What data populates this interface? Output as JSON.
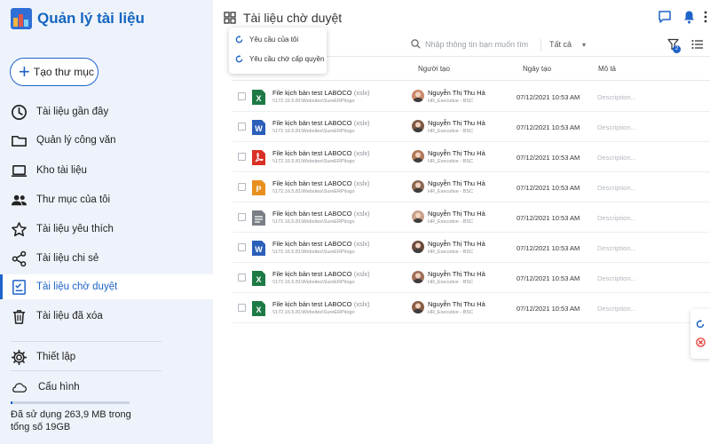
{
  "app": {
    "title": "Quản lý tài liệu"
  },
  "sidebar": {
    "new_folder_label": "Tạo thư mục",
    "items": [
      {
        "label": "Tài liệu gần đây",
        "icon": "clock-icon"
      },
      {
        "label": "Quản lý công văn",
        "icon": "folder-icon"
      },
      {
        "label": "Kho  tài liệu",
        "icon": "laptop-icon"
      },
      {
        "label": "Thư mục  của tôi",
        "icon": "people-icon"
      },
      {
        "label": "Tài liệu yêu thích",
        "icon": "star-icon"
      },
      {
        "label": "Tài liệu chi sẻ",
        "icon": "share-icon"
      },
      {
        "label": "Tài liệu chờ duyệt",
        "icon": "checklist-icon",
        "active": true
      },
      {
        "label": "Tài liệu đã xóa",
        "icon": "trash-icon"
      }
    ],
    "settings_label": "Thiết lập",
    "config_label": "Cấu hình",
    "storage": {
      "text": "Đã sử dụng 263,9 MB trong tổng số 19GB",
      "fraction": 0.0136
    }
  },
  "header": {
    "title": "Tài liệu chờ duyệt",
    "dropdown": [
      "Yêu cầu của tôi",
      "Yêu cầu chờ cấp quyền"
    ],
    "search_placeholder": "Nhập thông tin bạn muốn tìm",
    "filter_value": "Tất cả",
    "filter_badge": "2"
  },
  "table": {
    "columns": [
      "Người tạo",
      "Ngày tạo",
      "Mô tả"
    ],
    "rows": [
      {
        "type": "excel",
        "name": "File kịch bản test LABOCO",
        "ext": "(xslx)",
        "path": "\\\\172.16.5.81\\Websites\\SureERP\\logo",
        "user": "Nguyễn Thị Thu Hà",
        "role": "HR_Executive - BSC",
        "date": "07/12/2021 10:53 AM",
        "desc": "Description..."
      },
      {
        "type": "word",
        "name": "File kịch bản test LABOCO",
        "ext": "(xslx)",
        "path": "\\\\172.16.5.81\\Websites\\SureERP\\logo",
        "user": "Nguyễn Thị Thu Hà",
        "role": "HR_Executive - BSC",
        "date": "07/12/2021 10:53 AM",
        "desc": "Description..."
      },
      {
        "type": "pdf",
        "name": "File kịch bản test LABOCO",
        "ext": "(xslx)",
        "path": "\\\\172.16.5.81\\Websites\\SureERP\\logo",
        "user": "Nguyễn Thị Thu Hà",
        "role": "HR_Executive - BSC",
        "date": "07/12/2021 10:53 AM",
        "desc": "Description..."
      },
      {
        "type": "powerpoint",
        "name": "File kịch bản test LABOCO",
        "ext": "(xslx)",
        "path": "\\\\172.16.5.81\\Websites\\SureERP\\logo",
        "user": "Nguyễn Thị Thu Hà",
        "role": "HR_Executive - BSC",
        "date": "07/12/2021 10:53 AM",
        "desc": "Description..."
      },
      {
        "type": "doc",
        "name": "File kịch bản test LABOCO",
        "ext": "(xslx)",
        "path": "\\\\172.16.5.81\\Websites\\SureERP\\logo",
        "user": "Nguyễn Thị Thu Hà",
        "role": "HR_Executive - BSC",
        "date": "07/12/2021 10:53 AM",
        "desc": "Description..."
      },
      {
        "type": "word",
        "name": "File kịch bản test LABOCO",
        "ext": "(xslx)",
        "path": "\\\\172.16.5.81\\Websites\\SureERP\\logo",
        "user": "Nguyễn Thị Thu Hà",
        "role": "HR_Executive - BSC",
        "date": "07/12/2021 10:53 AM",
        "desc": "Description..."
      },
      {
        "type": "excel",
        "name": "File kịch bản test LABOCO",
        "ext": "(xslx)",
        "path": "\\\\172.16.5.81\\Websites\\SureERP\\logo",
        "user": "Nguyễn Thị Thu Hà",
        "role": "HR_Executive - BSC",
        "date": "07/12/2021 10:53 AM",
        "desc": "Description..."
      },
      {
        "type": "excel",
        "name": "File kịch bản test LABOCO",
        "ext": "(xslx)",
        "path": "\\\\172.16.5.81\\Websites\\SureERP\\logo",
        "user": "Nguyễn Thị Thu Hà",
        "role": "HR_Executive - BSC",
        "date": "07/12/2021 10:53 AM",
        "desc": "Description..."
      }
    ]
  },
  "colors": {
    "accent": "#1e63c9",
    "sidebar_bg": "#eef3fb",
    "excel": "#1e7a45",
    "word": "#2b5fb9",
    "pdf": "#d93025",
    "powerpoint": "#e8901f",
    "doc": "#7a7f87"
  }
}
